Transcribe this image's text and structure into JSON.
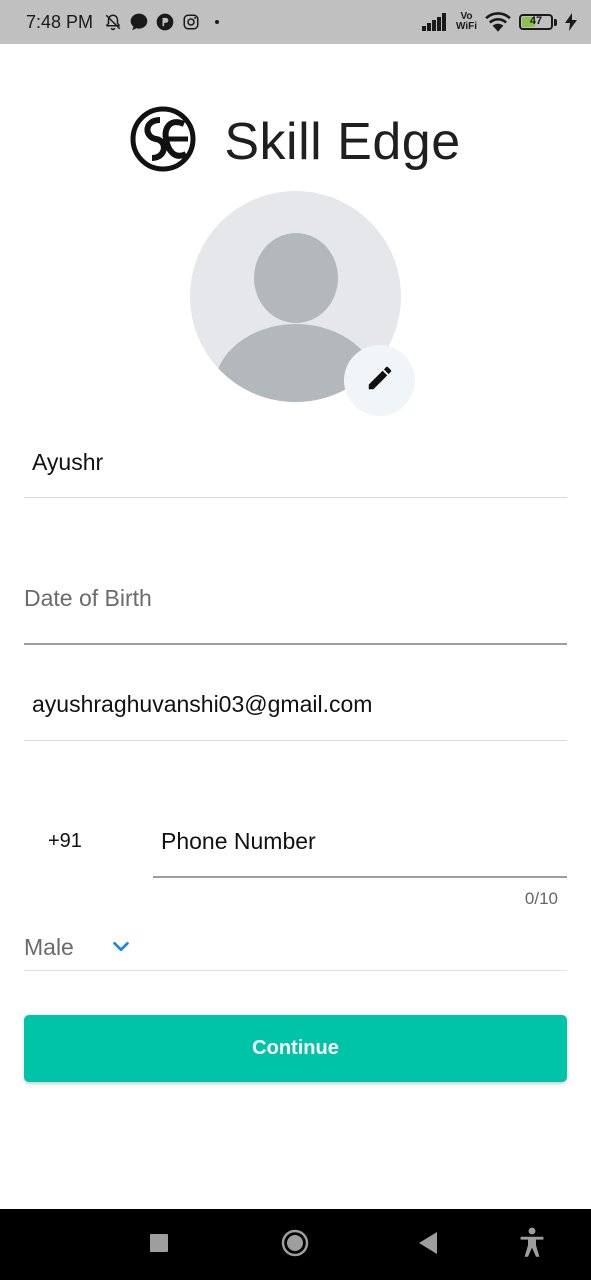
{
  "status_bar": {
    "time": "7:48 PM",
    "left_icons": [
      "bell-off-icon",
      "chat-bubble-icon",
      "p-app-icon",
      "instagram-icon",
      "dot-icon"
    ],
    "network_label_top": "Vo",
    "network_label_bottom": "WiFi",
    "battery_level": "47",
    "battery_fill_fraction": 0.47,
    "battery_color": "#8ac34a"
  },
  "brand": {
    "name": "Skill Edge"
  },
  "profile": {
    "name_value": "Ayushr",
    "dob_placeholder": "Date of Birth",
    "email_value": "ayushraghuvanshi03@gmail.com",
    "country_code": "+91",
    "phone_placeholder": "Phone Number",
    "phone_counter": "0/10",
    "gender_selected": "Male"
  },
  "actions": {
    "continue_label": "Continue"
  },
  "colors": {
    "accent": "#00c4a7",
    "chevron": "#1e88e5"
  }
}
